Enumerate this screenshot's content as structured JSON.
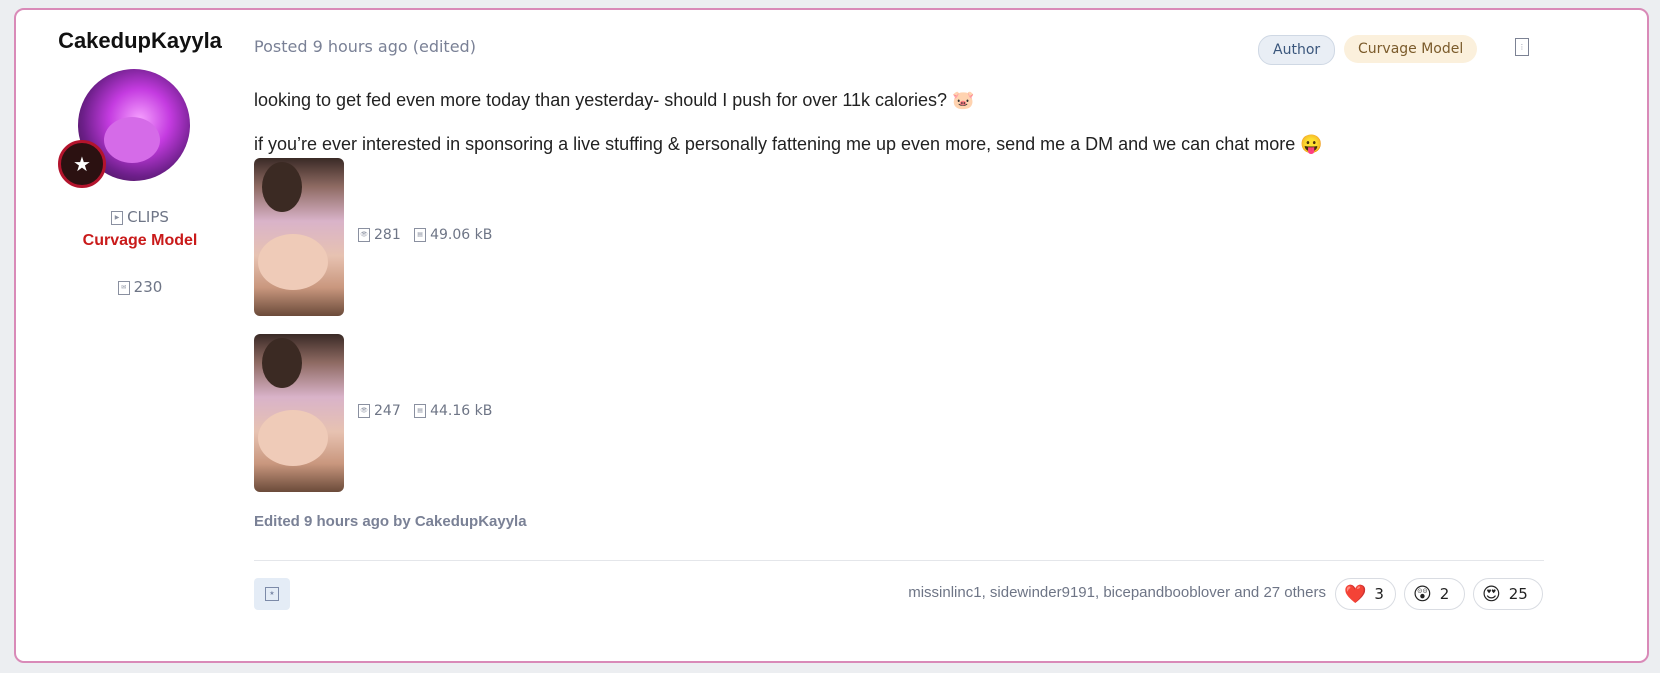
{
  "post": {
    "author": {
      "username": "CakedupKayyla",
      "clips_label": "CLIPS",
      "role": "Curvage Model",
      "message_count": "230"
    },
    "posted": "Posted 9 hours ago (edited)",
    "tags": {
      "author": "Author",
      "curvage_model": "Curvage Model"
    },
    "body": {
      "line1": "looking to get fed even more today than yesterday- should I push for over 11k calories? 🐷",
      "line2": "if you’re ever interested in sponsoring a live stuffing & personally fattening me up even more, send me a DM and we can chat more 😛"
    },
    "attachments": [
      {
        "views": "281",
        "size": "49.06 kB"
      },
      {
        "views": "247",
        "size": "44.16 kB"
      }
    ],
    "edited_note": "Edited 9 hours ago by CakedupKayyla",
    "reactors": "missinlinc1, sidewinder9191, bicepandbooblover and 27 others",
    "reactions": [
      {
        "emoji": "❤️",
        "count": "3"
      },
      {
        "emoji": "😲",
        "count": "2"
      },
      {
        "emoji": "😍",
        "count": "25"
      }
    ]
  },
  "icons": {
    "clips": "video-icon",
    "messages": "message-icon",
    "views": "eye-icon",
    "size": "file-icon",
    "bookmark": "bookmark-icon",
    "menu": "more-icon"
  },
  "colors": {
    "card_border": "#d98ab8",
    "role_red": "#c91a1a",
    "muted": "#7a8196"
  }
}
